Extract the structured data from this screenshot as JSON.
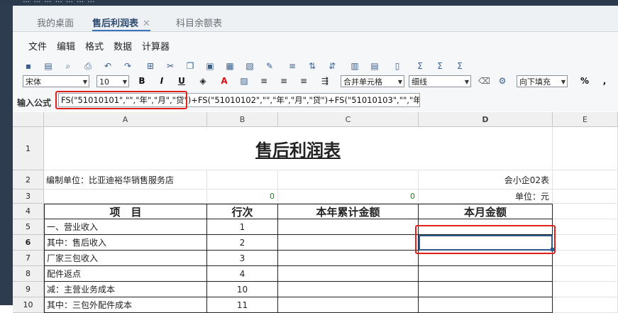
{
  "window": {
    "title_fragment": "·… … …  …  …  … …"
  },
  "tabs": [
    {
      "label": "我的桌面",
      "active": false
    },
    {
      "label": "售后利润表",
      "active": true,
      "close": "✕"
    },
    {
      "label": "科目余额表",
      "active": false
    }
  ],
  "menu": [
    "文件",
    "编辑",
    "格式",
    "数据",
    "计算器"
  ],
  "toolbar": {
    "font": "宋体",
    "size": "10",
    "bold": "B",
    "italic": "I",
    "underline": "U",
    "merge": "合并单元格",
    "border": "细线",
    "fill": "向下填充",
    "percent": "%",
    "comma": ","
  },
  "formula": {
    "label": "输入公式",
    "value": "FS(\"51010101\",\"\",\"年\",\"月\",\"贷\")+FS(\"51010102\",\"\",\"年\",\"月\",\"贷\")+FS(\"51010103\",\"\",\"年\",\"月\",\"贷"
  },
  "columns": [
    "A",
    "B",
    "C",
    "D",
    "E"
  ],
  "sheet": {
    "title": "售后利润表",
    "unit_prefix": "编制单位：",
    "company": "比亚迪裕华销售服务店",
    "form_no": "会小企02表",
    "unit_label": "单位：元",
    "zero_b": "0",
    "zero_c": "0",
    "headers": [
      "项　目",
      "行次",
      "本年累计金额",
      "本月金额"
    ],
    "rows": [
      {
        "num": "5",
        "item": "一、营业收入",
        "line": "1"
      },
      {
        "num": "6",
        "item": "其中：售后收入",
        "line": "2"
      },
      {
        "num": "7",
        "item": "厂家三包收入",
        "line": "3"
      },
      {
        "num": "8",
        "item": "配件返点",
        "line": "4"
      },
      {
        "num": "9",
        "item": "减：主营业务成本",
        "line": "10"
      },
      {
        "num": "10",
        "item": "其中：三包外配件成本",
        "line": "11"
      }
    ],
    "row_numbers": [
      "1",
      "2",
      "3",
      "4"
    ]
  },
  "accent": "#e0201a"
}
